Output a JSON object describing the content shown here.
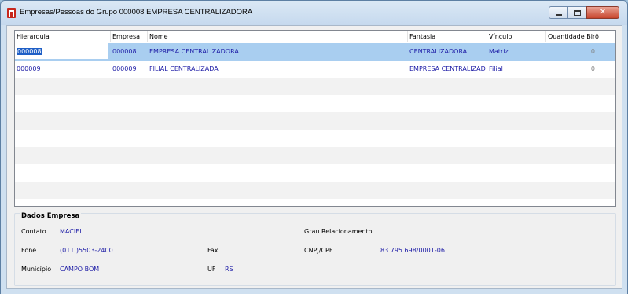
{
  "window": {
    "title": "Empresas/Pessoas do Grupo 000008 EMPRESA CENTRALIZADORA",
    "controls": {
      "minimize": "minimize",
      "maximize": "maximize",
      "close": "✕"
    }
  },
  "grid": {
    "columns": [
      "Hierarquia",
      "Empresa",
      "Nome",
      "Fantasia",
      "Vínculo",
      "Quantidade Birô"
    ],
    "rows": [
      {
        "hierarquia": "000008",
        "empresa": "000008",
        "nome": "EMPRESA CENTRALIZADORA",
        "fantasia": "CENTRALIZADORA",
        "vinculo": "Matriz",
        "quantidade": "0"
      },
      {
        "hierarquia": "000009",
        "empresa": "000009",
        "nome": "FILIAL CENTRALIZADA",
        "fantasia": "EMPRESA CENTRALIZAD",
        "vinculo": "Filial",
        "quantidade": "0"
      }
    ]
  },
  "dados_empresa": {
    "title": "Dados Empresa",
    "contato_label": "Contato",
    "contato_value": "MACIEL",
    "grau_label": "Grau Relacionamento",
    "grau_value": "",
    "fone_label": "Fone",
    "fone_value": "(011 )5503-2400",
    "fax_label": "Fax",
    "fax_value": "",
    "cnpj_label": "CNPJ/CPF",
    "cnpj_value": "83.795.698/0001-06",
    "municipio_label": "Município",
    "municipio_value": "CAMPO BOM",
    "uf_label": "UF",
    "uf_value": "RS"
  },
  "colors": {
    "selection": "#a9cef0",
    "value_text": "#1d1ca6",
    "window_frame": "#cfe0f0"
  }
}
